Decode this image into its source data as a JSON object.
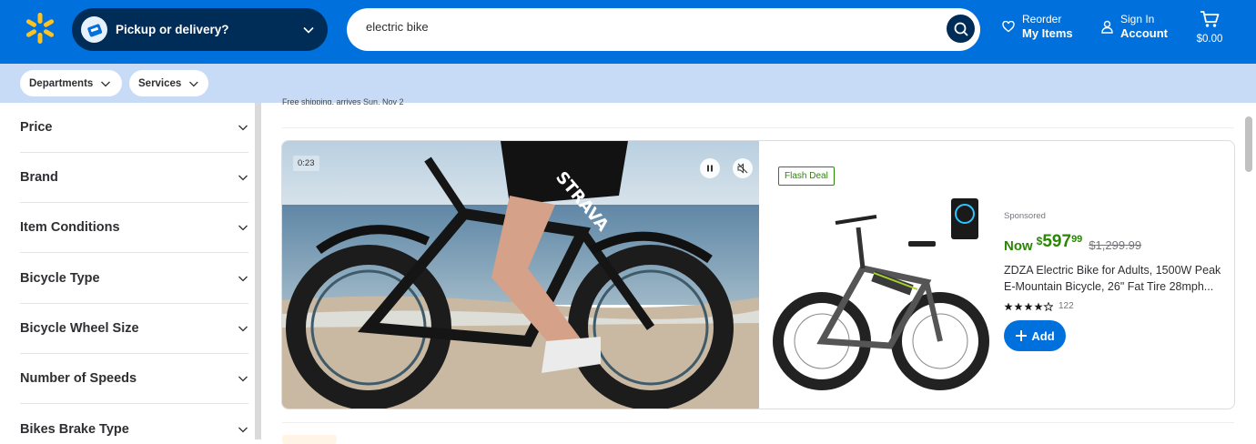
{
  "header": {
    "pickup_label": "Pickup or delivery?",
    "search_value": "electric bike",
    "reorder_small": "Reorder",
    "reorder_big": "My Items",
    "account_small": "Sign In",
    "account_big": "Account",
    "cart_amount": "$0.00",
    "brand_color": "#0071dc",
    "dark_blue": "#002d58"
  },
  "subnav": {
    "departments": "Departments",
    "services": "Services"
  },
  "filters": [
    {
      "label": "Price"
    },
    {
      "label": "Brand"
    },
    {
      "label": "Item Conditions"
    },
    {
      "label": "Bicycle Type"
    },
    {
      "label": "Bicycle Wheel Size"
    },
    {
      "label": "Number of Speeds"
    },
    {
      "label": "Bikes Brake Type"
    }
  ],
  "main": {
    "partial_shipping_text": "Free shipping, arrives Sun, Nov 2"
  },
  "sponsored_card": {
    "video_time": "0:23",
    "flash_deal": "Flash Deal",
    "sponsored_label": "Sponsored",
    "price_now_label": "Now",
    "price_dollar_sign": "$",
    "price_whole": "597",
    "price_cents": "99",
    "price_was": "$1,299.99",
    "title": "ZDZA Electric Bike for Adults, 1500W Peak E-Mountain Bicycle, 26\" Fat Tire 28mph...",
    "rating": 4,
    "rating_max": 5,
    "review_count": "122",
    "add_label": "Add",
    "price_color": "#2a8703"
  }
}
